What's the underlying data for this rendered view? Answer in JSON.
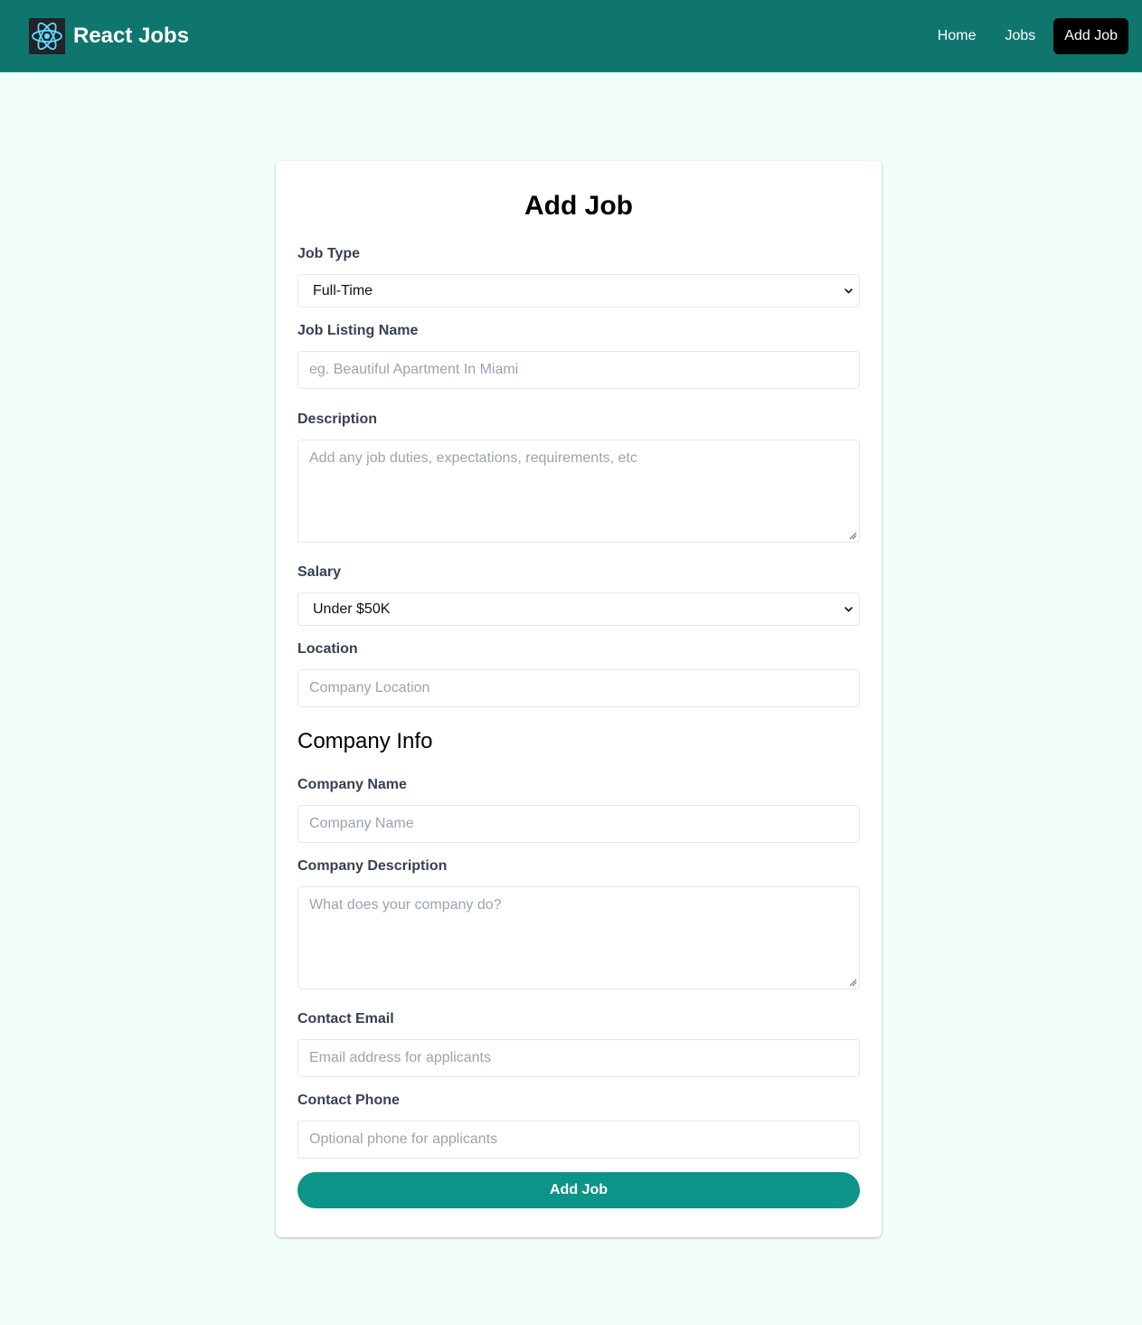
{
  "navbar": {
    "brand": "React Jobs",
    "links": [
      {
        "label": "Home"
      },
      {
        "label": "Jobs"
      },
      {
        "label": "Add Job"
      }
    ]
  },
  "form": {
    "title": "Add Job",
    "job_type": {
      "label": "Job Type",
      "value": "Full-Time"
    },
    "listing_name": {
      "label": "Job Listing Name",
      "placeholder": "eg. Beautiful Apartment In Miami"
    },
    "description": {
      "label": "Description",
      "placeholder": "Add any job duties, expectations, requirements, etc"
    },
    "salary": {
      "label": "Salary",
      "value": "Under $50K"
    },
    "location": {
      "label": "Location",
      "placeholder": "Company Location"
    },
    "company_section_title": "Company Info",
    "company_name": {
      "label": "Company Name",
      "placeholder": "Company Name"
    },
    "company_description": {
      "label": "Company Description",
      "placeholder": "What does your company do?"
    },
    "contact_email": {
      "label": "Contact Email",
      "placeholder": "Email address for applicants"
    },
    "contact_phone": {
      "label": "Contact Phone",
      "placeholder": "Optional phone for applicants"
    },
    "submit_label": "Add Job"
  },
  "icons": {
    "logo": "react-logo-icon",
    "dropdown": "chevron-down-icon",
    "resize": "resize-handle-icon"
  },
  "colors": {
    "navbar_background": "#0f766e",
    "page_background": "#f0fdfa",
    "primary_button": "#0d9488",
    "active_nav_background": "#000000",
    "react_logo": "#61dafb"
  }
}
